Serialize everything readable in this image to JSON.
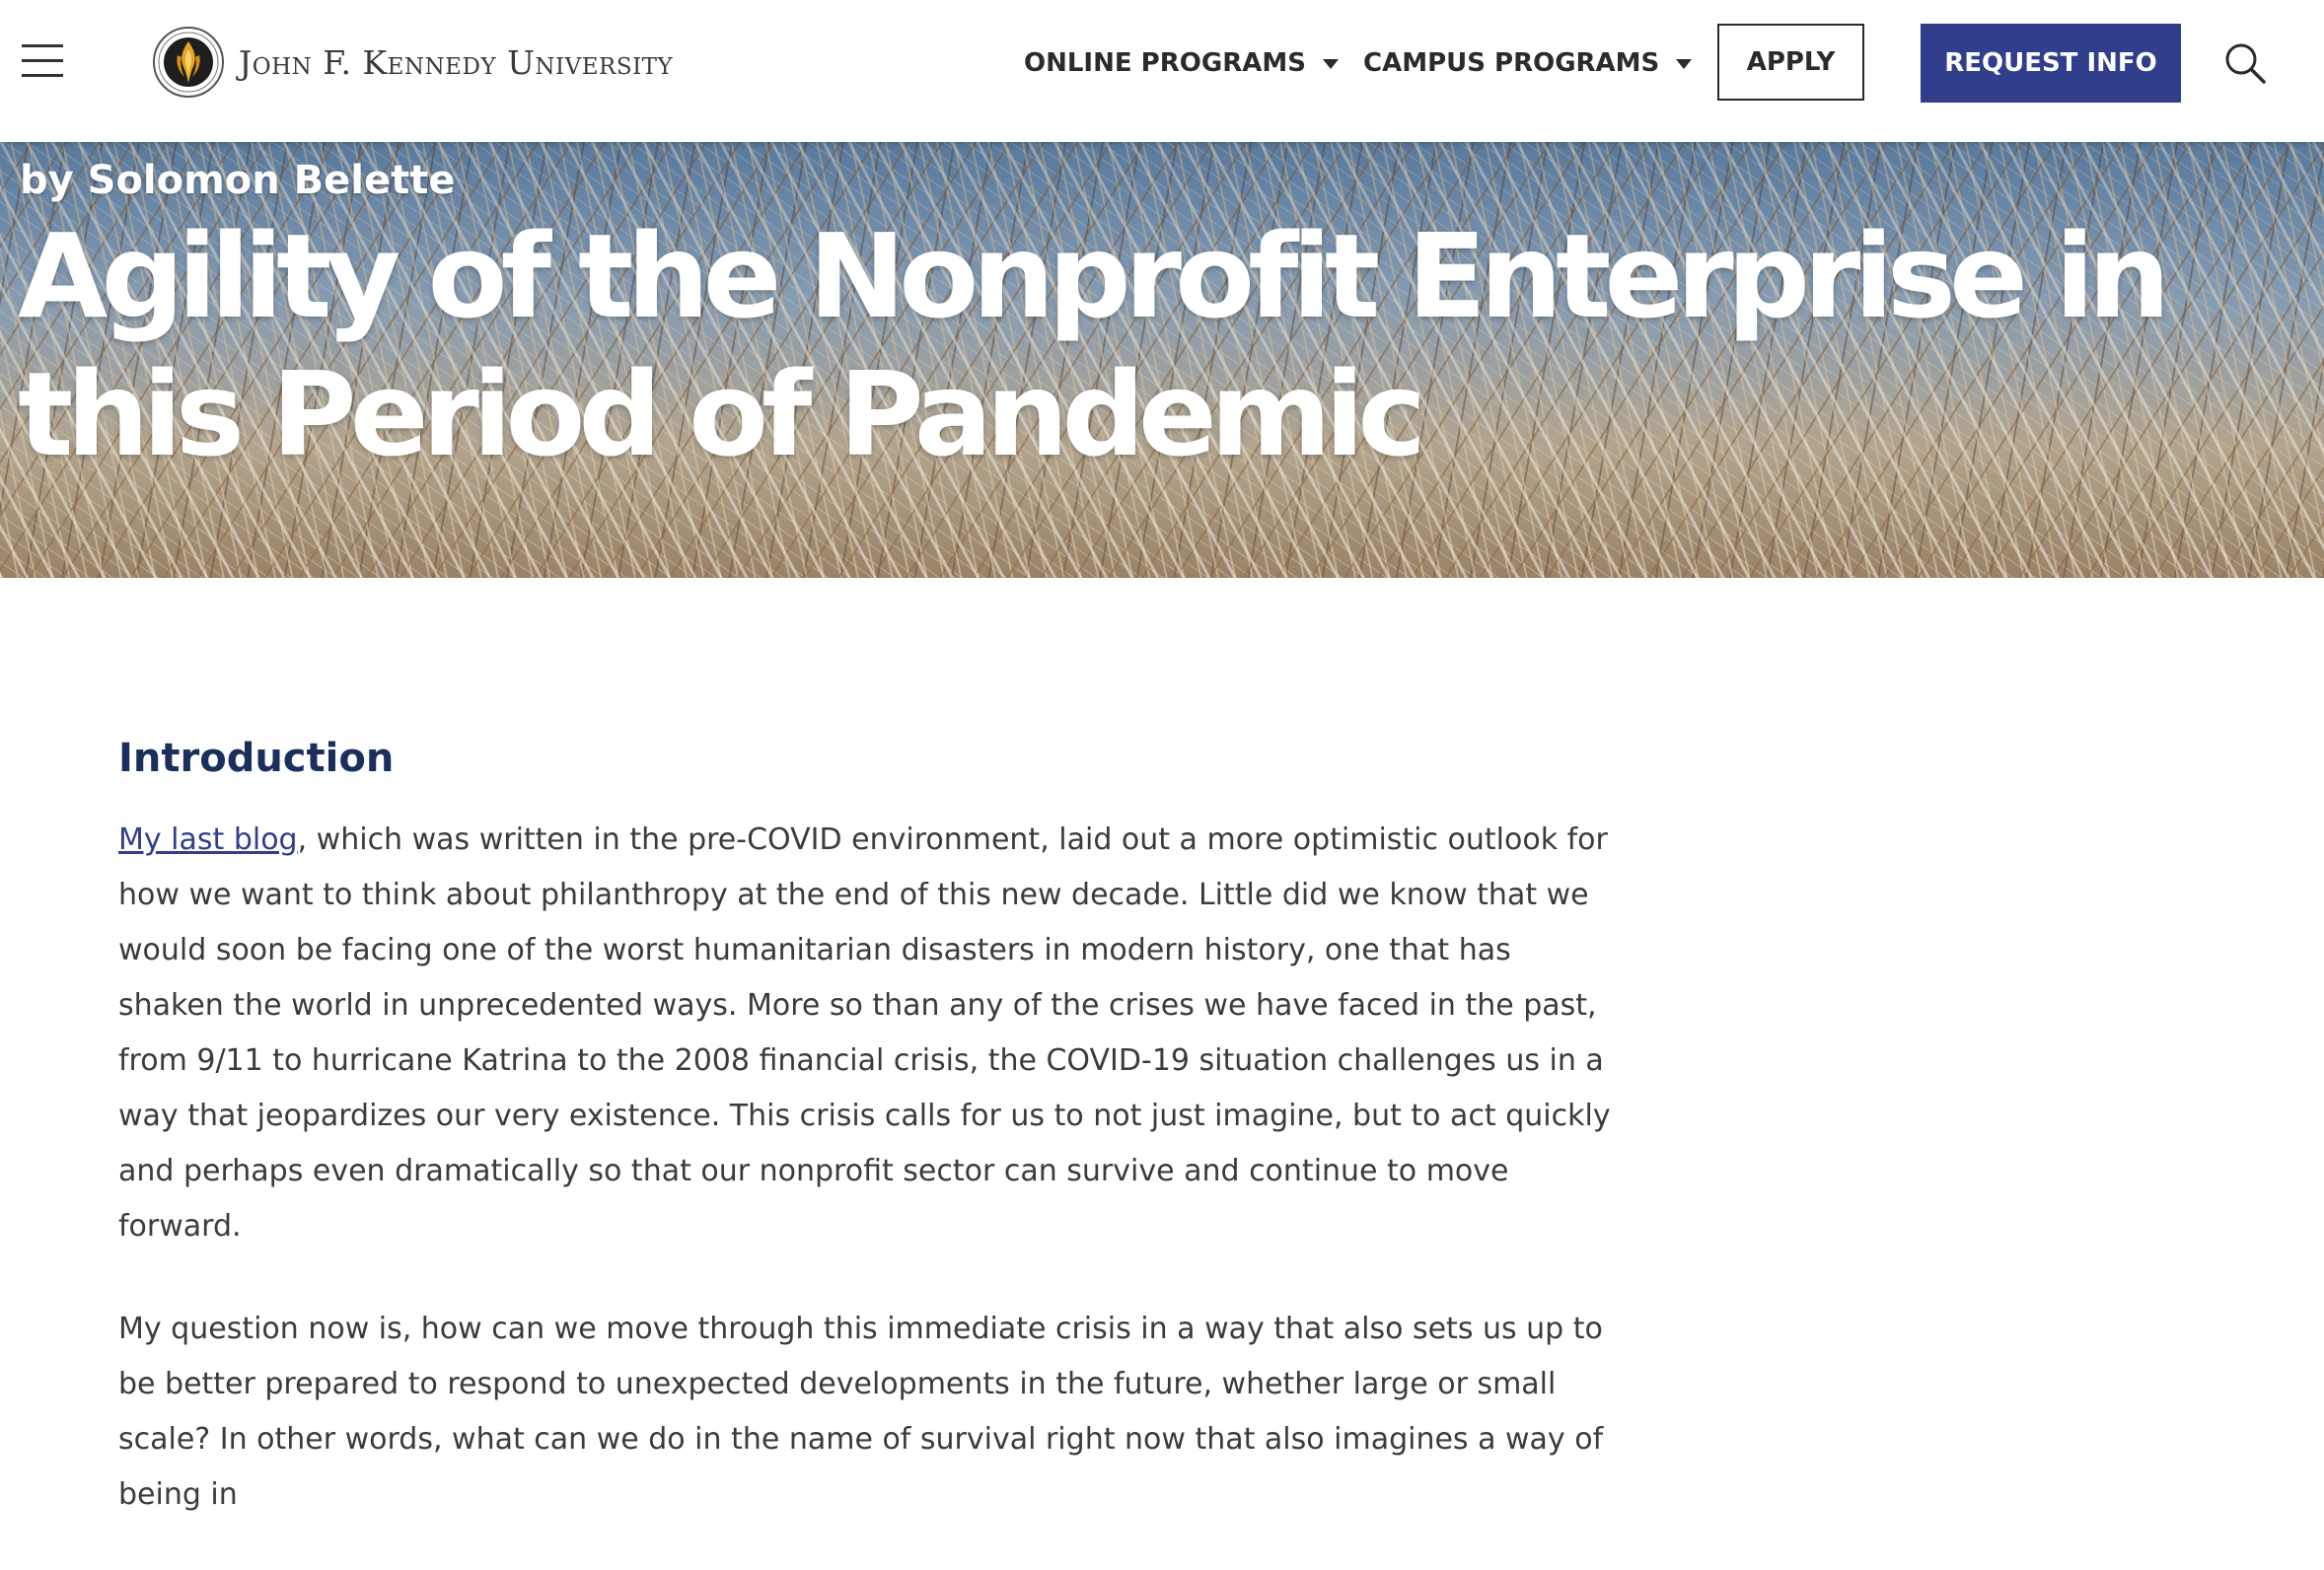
{
  "header": {
    "menu_icon": "hamburger-menu-icon",
    "logo_icon": "university-seal-icon",
    "logo_text": "John F. Kennedy University",
    "nav": [
      {
        "label": "ONLINE PROGRAMS",
        "icon": "caret-down-icon"
      },
      {
        "label": "CAMPUS PROGRAMS",
        "icon": "caret-down-icon"
      }
    ],
    "apply_label": "APPLY",
    "request_info_label": "REQUEST INFO",
    "search_icon": "search-icon",
    "colors": {
      "brand_navy": "#303e8c",
      "text_dark": "#2b2b2b"
    }
  },
  "hero": {
    "byline": "by Solomon Belette",
    "title": "Agility of the Nonprofit Enterprise in this Period of Pandemic"
  },
  "article": {
    "heading": "Introduction",
    "heading_color": "#1b2f5e",
    "paragraphs": [
      {
        "link_text": "My last blog",
        "text": ", which was written in the pre-COVID environment, laid out a more optimistic outlook for how we want to think about philanthropy at the end of this new decade. Little did we know that we would soon be facing one of the worst humanitarian disasters in modern history, one that has shaken the world in unprecedented ways. More so than any of the crises we have faced in the past, from 9/11 to hurricane Katrina to the 2008 financial crisis, the COVID-19 situation challenges us in a way that jeopardizes our very existence. This crisis calls for us to not just imagine, but to act quickly and perhaps even dramatically so that our nonprofit sector can survive and continue to move forward."
      },
      {
        "text": "My question now is, how can we move through this immediate crisis in a way that also sets us up to be better prepared to respond to unexpected developments in the future, whether large or small scale? In other words, what can we do in the name of survival right now that also imagines a way of being in"
      }
    ]
  }
}
